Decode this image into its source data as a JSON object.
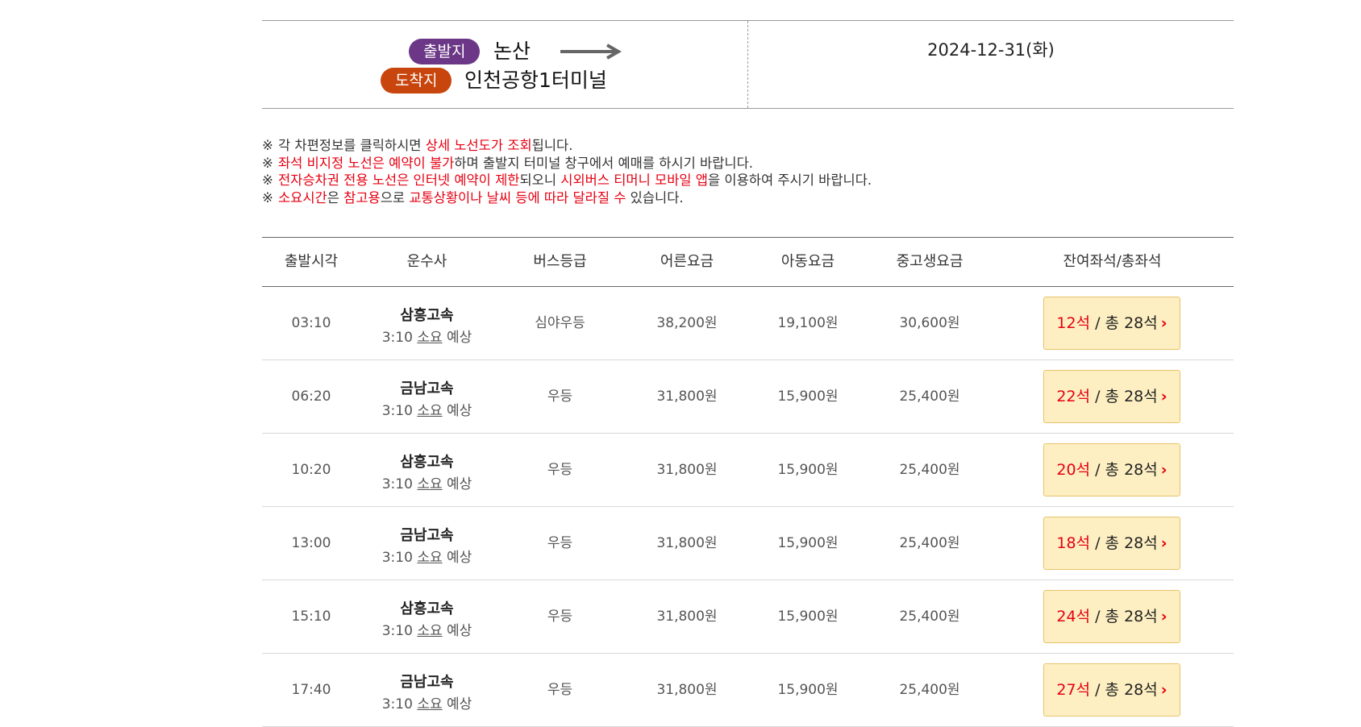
{
  "route": {
    "departure_badge": "출발지",
    "departure_place": "논산",
    "arrival_badge": "도착지",
    "arrival_place": "인천공항1터미널",
    "date": "2024-12-31(화)",
    "colors": {
      "departure_badge": "#6b3786",
      "arrival_badge": "#c8460d"
    }
  },
  "notices": [
    {
      "segments": [
        {
          "text": "각 차편정보를 클릭하시면 ",
          "hl": false
        },
        {
          "text": "상세 노선도가 조회",
          "hl": true
        },
        {
          "text": "됩니다.",
          "hl": false
        }
      ]
    },
    {
      "segments": [
        {
          "text": "좌석 비지정 노선은 예약이 불가",
          "hl": true
        },
        {
          "text": "하며 출발지 터미널 창구에서 예매를 하시기 바랍니다.",
          "hl": false
        }
      ]
    },
    {
      "segments": [
        {
          "text": "전자승차권 전용 노선은 인터넷 예약이 제한",
          "hl": true
        },
        {
          "text": "되오니 ",
          "hl": false
        },
        {
          "text": "시외버스 티머니 모바일 앱",
          "hl": true
        },
        {
          "text": "을 이용하여 주시기 바랍니다.",
          "hl": false
        }
      ]
    },
    {
      "segments": [
        {
          "text": "소요시간",
          "hl": true
        },
        {
          "text": "은 ",
          "hl": false
        },
        {
          "text": "참고용",
          "hl": true
        },
        {
          "text": "으로 ",
          "hl": false
        },
        {
          "text": "교통상황이나 날씨 등에 따라 달라질 수",
          "hl": true
        },
        {
          "text": " 있습니다.",
          "hl": false
        }
      ]
    }
  ],
  "notice_mark": "※",
  "table": {
    "headers": [
      "출발시각",
      "운수사",
      "버스등급",
      "어른요금",
      "아동요금",
      "중고생요금",
      "잔여좌석/총좌석"
    ],
    "duration_prefix": "3:10",
    "duration_mid": "소요",
    "duration_suffix": "예상",
    "seat_total_label": " / 총 28석",
    "rows": [
      {
        "time": "03:10",
        "company": "삼흥고속",
        "grade": "심야우등",
        "adult": "38,200원",
        "child": "19,100원",
        "student": "30,600원",
        "remaining": "12석"
      },
      {
        "time": "06:20",
        "company": "금남고속",
        "grade": "우등",
        "adult": "31,800원",
        "child": "15,900원",
        "student": "25,400원",
        "remaining": "22석"
      },
      {
        "time": "10:20",
        "company": "삼흥고속",
        "grade": "우등",
        "adult": "31,800원",
        "child": "15,900원",
        "student": "25,400원",
        "remaining": "20석"
      },
      {
        "time": "13:00",
        "company": "금남고속",
        "grade": "우등",
        "adult": "31,800원",
        "child": "15,900원",
        "student": "25,400원",
        "remaining": "18석"
      },
      {
        "time": "15:10",
        "company": "삼흥고속",
        "grade": "우등",
        "adult": "31,800원",
        "child": "15,900원",
        "student": "25,400원",
        "remaining": "24석"
      },
      {
        "time": "17:40",
        "company": "금남고속",
        "grade": "우등",
        "adult": "31,800원",
        "child": "15,900원",
        "student": "25,400원",
        "remaining": "27석"
      }
    ]
  }
}
